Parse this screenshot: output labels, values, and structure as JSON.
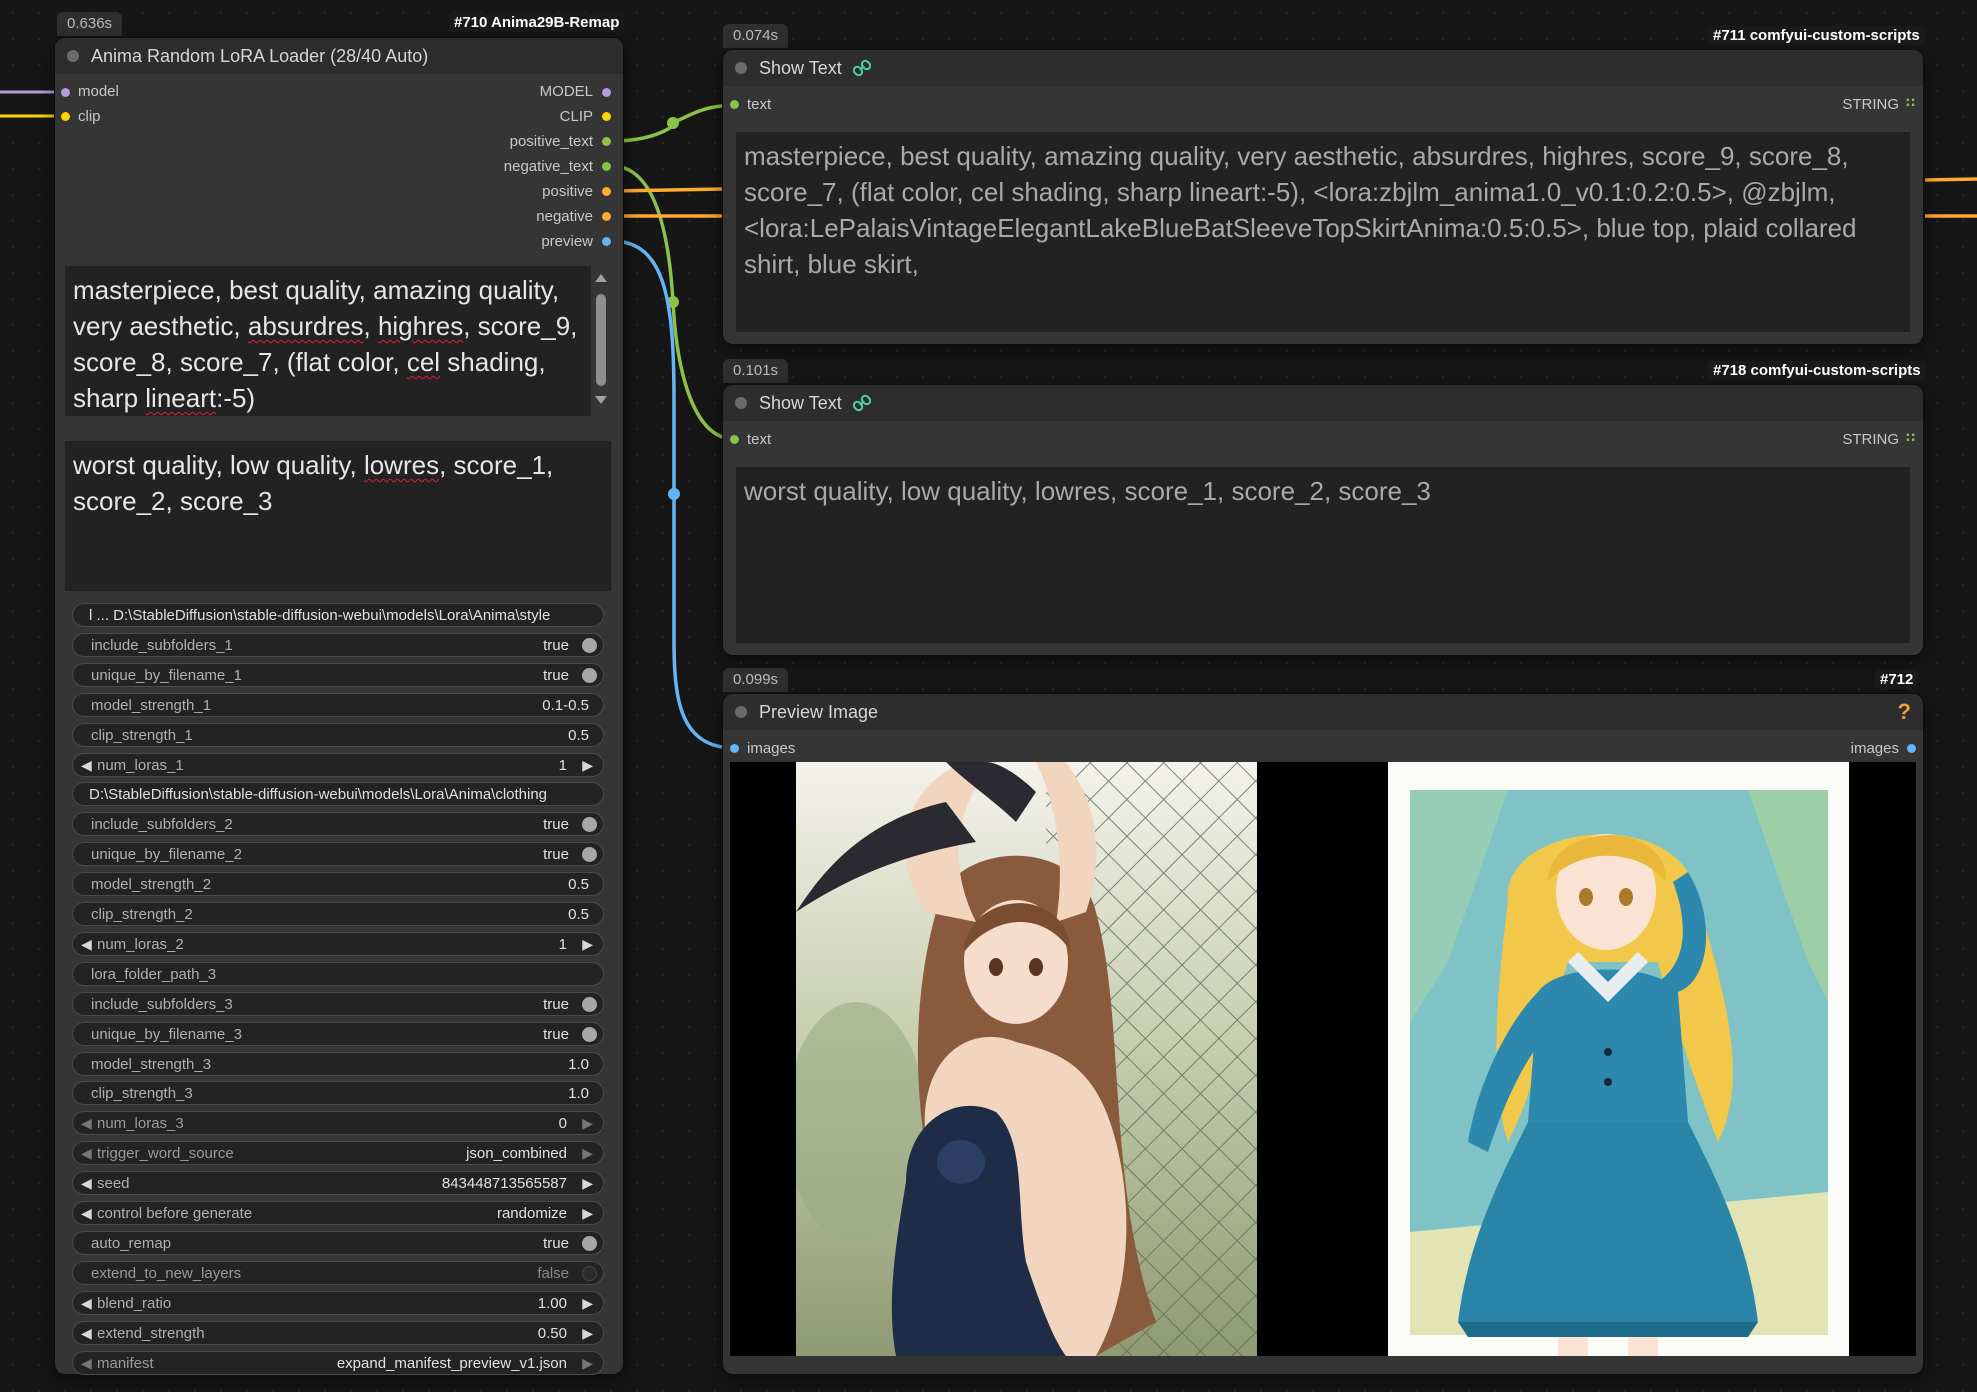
{
  "colors": {
    "model": "#b39ddb",
    "clip": "#ffd500",
    "string": "#8bc34a",
    "conditioning": "#ffa931",
    "image": "#64b5f6"
  },
  "loader": {
    "time": "0.636s",
    "id": "#710 Anima29B-Remap",
    "title": "Anima Random LoRA Loader (28/40 Auto)",
    "inputs": [
      "model",
      "clip"
    ],
    "outputs": [
      "MODEL",
      "CLIP",
      "positive_text",
      "negative_text",
      "positive",
      "negative",
      "preview"
    ],
    "positive_prompt": [
      {
        "t": "masterpiece, best quality, amazing quality, very aesthetic, "
      },
      {
        "t": "absurdres",
        "err": true
      },
      {
        "t": ", "
      },
      {
        "t": "highres",
        "err": true
      },
      {
        "t": ", score_9, score_8, score_7, (flat color, "
      },
      {
        "t": "cel",
        "err": true
      },
      {
        "t": " shading, sharp "
      },
      {
        "t": "lineart",
        "err": true
      },
      {
        "t": ":-5)"
      }
    ],
    "negative_prompt": [
      {
        "t": "worst quality, low quality, "
      },
      {
        "t": "lowres",
        "err": true
      },
      {
        "t": ", score_1, score_2, score_3"
      }
    ],
    "widgets": [
      {
        "kind": "path",
        "label": "l ...  D:\\StableDiffusion\\stable-diffusion-webui\\models\\Lora\\Anima\\style"
      },
      {
        "kind": "toggle",
        "label": "include_subfolders_1",
        "value": "true",
        "on": true
      },
      {
        "kind": "toggle",
        "label": "unique_by_filename_1",
        "value": "true",
        "on": true
      },
      {
        "kind": "text",
        "label": "model_strength_1",
        "value": "0.1-0.5"
      },
      {
        "kind": "text",
        "label": "clip_strength_1",
        "value": "0.5"
      },
      {
        "kind": "number",
        "label": "num_loras_1",
        "value": "1"
      },
      {
        "kind": "path",
        "label": "D:\\StableDiffusion\\stable-diffusion-webui\\models\\Lora\\Anima\\clothing"
      },
      {
        "kind": "toggle",
        "label": "include_subfolders_2",
        "value": "true",
        "on": true
      },
      {
        "kind": "toggle",
        "label": "unique_by_filename_2",
        "value": "true",
        "on": true
      },
      {
        "kind": "text",
        "label": "model_strength_2",
        "value": "0.5"
      },
      {
        "kind": "text",
        "label": "clip_strength_2",
        "value": "0.5"
      },
      {
        "kind": "number",
        "label": "num_loras_2",
        "value": "1"
      },
      {
        "kind": "text",
        "label": "lora_folder_path_3",
        "value": ""
      },
      {
        "kind": "toggle",
        "label": "include_subfolders_3",
        "value": "true",
        "on": true
      },
      {
        "kind": "toggle",
        "label": "unique_by_filename_3",
        "value": "true",
        "on": true
      },
      {
        "kind": "text",
        "label": "model_strength_3",
        "value": "1.0"
      },
      {
        "kind": "text",
        "label": "clip_strength_3",
        "value": "1.0"
      },
      {
        "kind": "number",
        "label": "num_loras_3",
        "value": "0",
        "dim": true
      },
      {
        "kind": "number",
        "label": "trigger_word_source",
        "value": "json_combined",
        "dim": true
      },
      {
        "kind": "number",
        "label": "seed",
        "value": "843448713565587"
      },
      {
        "kind": "number",
        "label": "control before generate",
        "value": "randomize"
      },
      {
        "kind": "toggle",
        "label": "auto_remap",
        "value": "true",
        "on": true
      },
      {
        "kind": "toggle",
        "label": "extend_to_new_layers",
        "value": "false",
        "on": false
      },
      {
        "kind": "number",
        "label": "blend_ratio",
        "value": "1.00"
      },
      {
        "kind": "number",
        "label": "extend_strength",
        "value": "0.50"
      },
      {
        "kind": "number",
        "label": "manifest",
        "value": "expand_manifest_preview_v1.json",
        "dim": true
      }
    ]
  },
  "show_text_1": {
    "time": "0.074s",
    "id": "#711 comfyui-custom-scripts",
    "title": "Show Text",
    "input": "text",
    "output": "STRING",
    "content": "masterpiece, best quality, amazing quality, very aesthetic, absurdres, highres, score_9, score_8, score_7, (flat color, cel shading, sharp lineart:-5), <lora:zbjlm_anima1.0_v0.1:0.2:0.5>, @zbjlm, <lora:LePalaisVintageElegantLakeBlueBatSleeveTopSkirtAnima:0.5:0.5>, blue top, plaid collared shirt, blue skirt,"
  },
  "show_text_2": {
    "time": "0.101s",
    "id": "#718 comfyui-custom-scripts",
    "title": "Show Text",
    "input": "text",
    "output": "STRING",
    "content": "worst quality, low quality, lowres, score_1, score_2, score_3"
  },
  "preview": {
    "time": "0.099s",
    "id": "#712",
    "title": "Preview Image",
    "input": "images",
    "output": "images",
    "help": "?"
  }
}
